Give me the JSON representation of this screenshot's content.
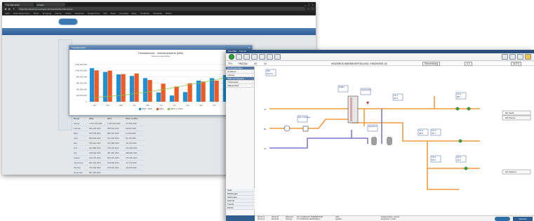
{
  "browser": {
    "tabs": [
      "Trendübersicht",
      "Google"
    ],
    "url": "https://trendrechner.example.com/trendrechner/trend.php",
    "bookmarks": [
      "Apps",
      "Hotel Reservation",
      "Music",
      "Shopping",
      "Games",
      "Online",
      "Facebook",
      "Google Drive",
      "IMA",
      "Maps",
      "Fernstaat",
      "Ebay",
      "Trendbüro",
      "Startseite",
      "Wetter"
    ],
    "modal_header": "Trendübersicht",
    "chart_close": "×"
  },
  "chart_data": {
    "type": "bar",
    "title": "Trendübersicht - Verbrauchswerte (kWh)",
    "subtitle": "Wärmemengenzähler",
    "categories": [
      "Jan",
      "Feb",
      "Mär",
      "Apr",
      "Mai",
      "Jun",
      "Jul",
      "Aug",
      "Sep",
      "Okt",
      "Nov",
      "Dez"
    ],
    "series": [
      {
        "name": "2013 - 2014",
        "type": "bar",
        "color": "#1f8fd6",
        "values": [
          1080000,
          960000,
          880000,
          830000,
          760000,
          300000,
          200000,
          310000,
          680000,
          760000,
          860000,
          900000
        ]
      },
      {
        "name": "2014",
        "type": "bar",
        "color": "#f05a22",
        "values": [
          1010000,
          1000000,
          890000,
          910000,
          700000,
          580000,
          490000,
          590000,
          650000,
          680000,
          0,
          0
        ]
      },
      {
        "name": "2014 vs. 2013",
        "type": "line",
        "color": "#8bc34a",
        "values": [
          130000,
          170000,
          200000,
          260000,
          310000,
          380000,
          460000,
          540000,
          610000,
          700000,
          790000,
          870000
        ]
      }
    ],
    "ylim": [
      0,
      1400000
    ],
    "yticks": [
      "0",
      "200.000 kWh",
      "400.000 kWh",
      "600.000 kWh",
      "800.000 kWh",
      "1.000.000 kWh",
      "1.200.000 kWh"
    ],
    "legend": "bottom-center"
  },
  "table": {
    "headers": [
      "Monat",
      "2013",
      "2014",
      "2014 vs 2013"
    ],
    "rows": [
      [
        "Januar",
        "1.087.930 kWh",
        "1.011.310 kWh",
        "-76.620 kWh"
      ],
      [
        "Februar",
        "960.120 kWh",
        "998.640 kWh",
        "38.520 kWh"
      ],
      [
        "März",
        "878.430 kWh",
        "889.760 kWh",
        "11.330 kWh"
      ],
      [
        "April",
        "829.050 kWh",
        "912.420 kWh",
        "83.370 kWh"
      ],
      [
        "Mai",
        "758.410 kWh",
        "701.980 kWh",
        "-56.430 kWh"
      ],
      [
        "Juni",
        "301.880 kWh",
        "578.140 kWh",
        "276.260 kWh"
      ],
      [
        "Juli",
        "198.520 kWh",
        "487.350 kWh",
        "288.830 kWh"
      ],
      [
        "August",
        "312.670 kWh",
        "589.210 kWh",
        "276.540 kWh"
      ],
      [
        "September",
        "681.030 kWh",
        "648.900 kWh",
        "-32.130 kWh"
      ],
      [
        "Oktober",
        "762.440 kWh",
        "679.020 kWh",
        "-83.420 kWh"
      ],
      [
        "November",
        "861.250 kWh",
        "",
        ""
      ],
      [
        "Dezember",
        "899.600 kWh",
        "",
        ""
      ]
    ]
  },
  "scada": {
    "title": "TF1 FBZ ... TF1 10",
    "info": {
      "left1": "TF1",
      "left2": "FBZ/ZW",
      "left3": "20",
      "left4": "10",
      "center": "HEIZKREIS WÄRMEVERTEILUNG / HEIZKREIS 1/2",
      "status_box": "Störmeldung",
      "val_box": "4.2",
      "end_box": "AUTO"
    },
    "menu_top": [
      {
        "label": "Heizungsanlage",
        "selected": true
      },
      {
        "label": "Heizkreis",
        "selected": false
      },
      {
        "label": "Lüftung",
        "selected": false
      },
      {
        "label": "Wärmeerzeugung",
        "selected": true
      },
      {
        "label": "Trinkwasser",
        "selected": false
      },
      {
        "label": "Kältetechnik",
        "selected": false
      }
    ],
    "menu_bottom": [
      "Start",
      "Meldungen",
      "Störungen",
      "Historie",
      "Trends",
      "Extras"
    ],
    "diagram": {
      "top_tag": "ZW\n21.5°C",
      "labels": {
        "vl1": "VL",
        "rl1": "RL",
        "vl2": "VL",
        "pump1": "HK 1 Pumpe",
        "valve1": "Ventil HK1",
        "sensor_a": "TF 1\n62.4",
        "sensor_b": "TF 2\n48.9",
        "sensor_c": "TF 3\n45.1",
        "sensor_d": "TF 4\n38.7",
        "sensor_e": "TF 5\n52.3",
        "sensor_f": "TF 6\n41.0",
        "vessel": "Speicher",
        "buffer": "Puffer"
      },
      "buttons": [
        "HK Ventil",
        "HK Pumpe",
        "HK Sollwert"
      ]
    },
    "status": {
      "col1": [
        "05.11.14",
        "05.11.14"
      ],
      "col2": [
        "09:12:31",
        "09:13:04"
      ],
      "col3": [
        "Warnung",
        "Störung"
      ],
      "col4": [
        "HK 1 VORLAUF TEMPERATUR",
        "TF STÖRUNG HEIZKREIS 2"
      ],
      "col5": [
        "Aktiv",
        "Quittiert"
      ],
      "col6": [
        "Anlagenstatus: normal",
        "Ereignisse: 2 offen"
      ],
      "button": "Optionen"
    }
  },
  "colors": {
    "pipe_supply": "#f39a3c",
    "pipe_return": "#7b79d4",
    "accent": "#2c5e93"
  }
}
